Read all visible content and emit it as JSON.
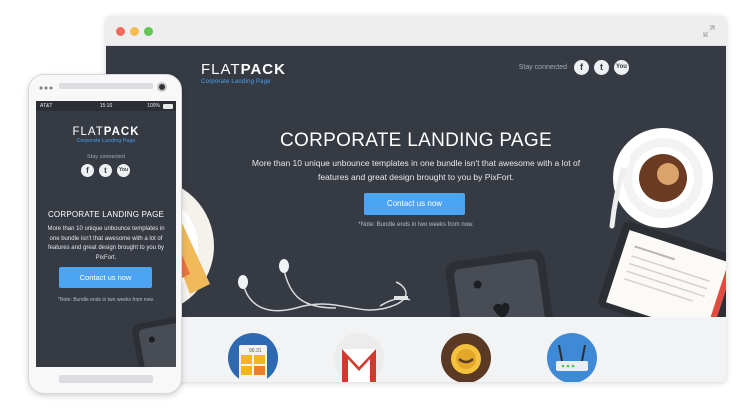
{
  "desktop": {
    "logo": {
      "main_a": "FLAT",
      "main_b": "PACK",
      "subtitle": "Corporate Landing Page"
    },
    "social": {
      "label": "Stay connected",
      "facebook": "f",
      "twitter": "t",
      "youtube": "You"
    },
    "hero": {
      "title": "CORPORATE LANDING PAGE",
      "description": "More than 10 unique unbounce templates in one bundle isn't that awesome with a lot of features and great design brought to you by PixFort.",
      "button": "Contact us now",
      "note": "*Note: Bundle ends in two weeks from now."
    },
    "lower_icons": [
      "calculator-app-icon",
      "gmail-app-icon",
      "coffee-app-icon",
      "router-app-icon"
    ]
  },
  "mobile": {
    "status": {
      "carrier": "AT&T",
      "time": "15:10",
      "battery": "100%"
    },
    "logo": {
      "main_a": "FLAT",
      "main_b": "PACK",
      "subtitle": "Corporate Landing Page"
    },
    "social": {
      "label": "Stay connected",
      "facebook": "f",
      "twitter": "t",
      "youtube": "You"
    },
    "hero": {
      "title": "CORPORATE LANDING PAGE",
      "description": "More than 10 unique unbounce templates in one bundle isn't that awesome with a lot of features and great design brought to you by PixFort.",
      "button": "Contact us now",
      "note": "*Note: Bundle ends in two weeks from now."
    }
  },
  "colors": {
    "hero_bg": "#363a42",
    "accent": "#4da3f4",
    "window_red": "#ef6b5e",
    "window_yellow": "#f5bd4f",
    "window_green": "#62c554"
  }
}
